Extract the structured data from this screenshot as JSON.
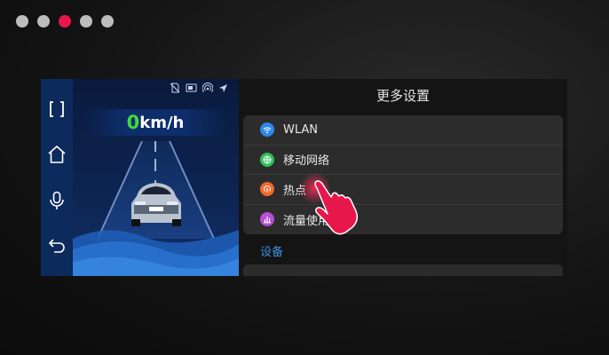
{
  "stepper": {
    "dots": 5,
    "active_index": 2,
    "colors": {
      "inactive": "#bdbdbd",
      "active": "#e8174b"
    }
  },
  "dashboard": {
    "speed_value": "0",
    "speed_unit": "km/h",
    "status_icons": [
      "sim-off-icon",
      "screen-cast-icon",
      "hotspot-icon",
      "navigation-icon"
    ],
    "colors": {
      "speed_value": "#3ddc3d",
      "panel": "#0c2a5c"
    }
  },
  "nav": {
    "items": [
      "fullscreen-icon",
      "home-icon",
      "microphone-icon",
      "back-icon"
    ]
  },
  "settings": {
    "title": "更多设置",
    "items": [
      {
        "label": "WLAN",
        "icon": "wifi-icon",
        "color": "#2f88e8"
      },
      {
        "label": "移动网络",
        "icon": "globe-icon",
        "color": "#2fbf5a"
      },
      {
        "label": "热点",
        "icon": "hotspot-icon",
        "color": "#ef6a2e"
      },
      {
        "label": "流量使用",
        "icon": "bar-chart-icon",
        "color": "#b44fd6"
      }
    ],
    "section_label": "设备",
    "accent_color": "#3d8fe0"
  },
  "gesture": {
    "icon": "tap-hand-icon",
    "color": "#e8174b"
  }
}
